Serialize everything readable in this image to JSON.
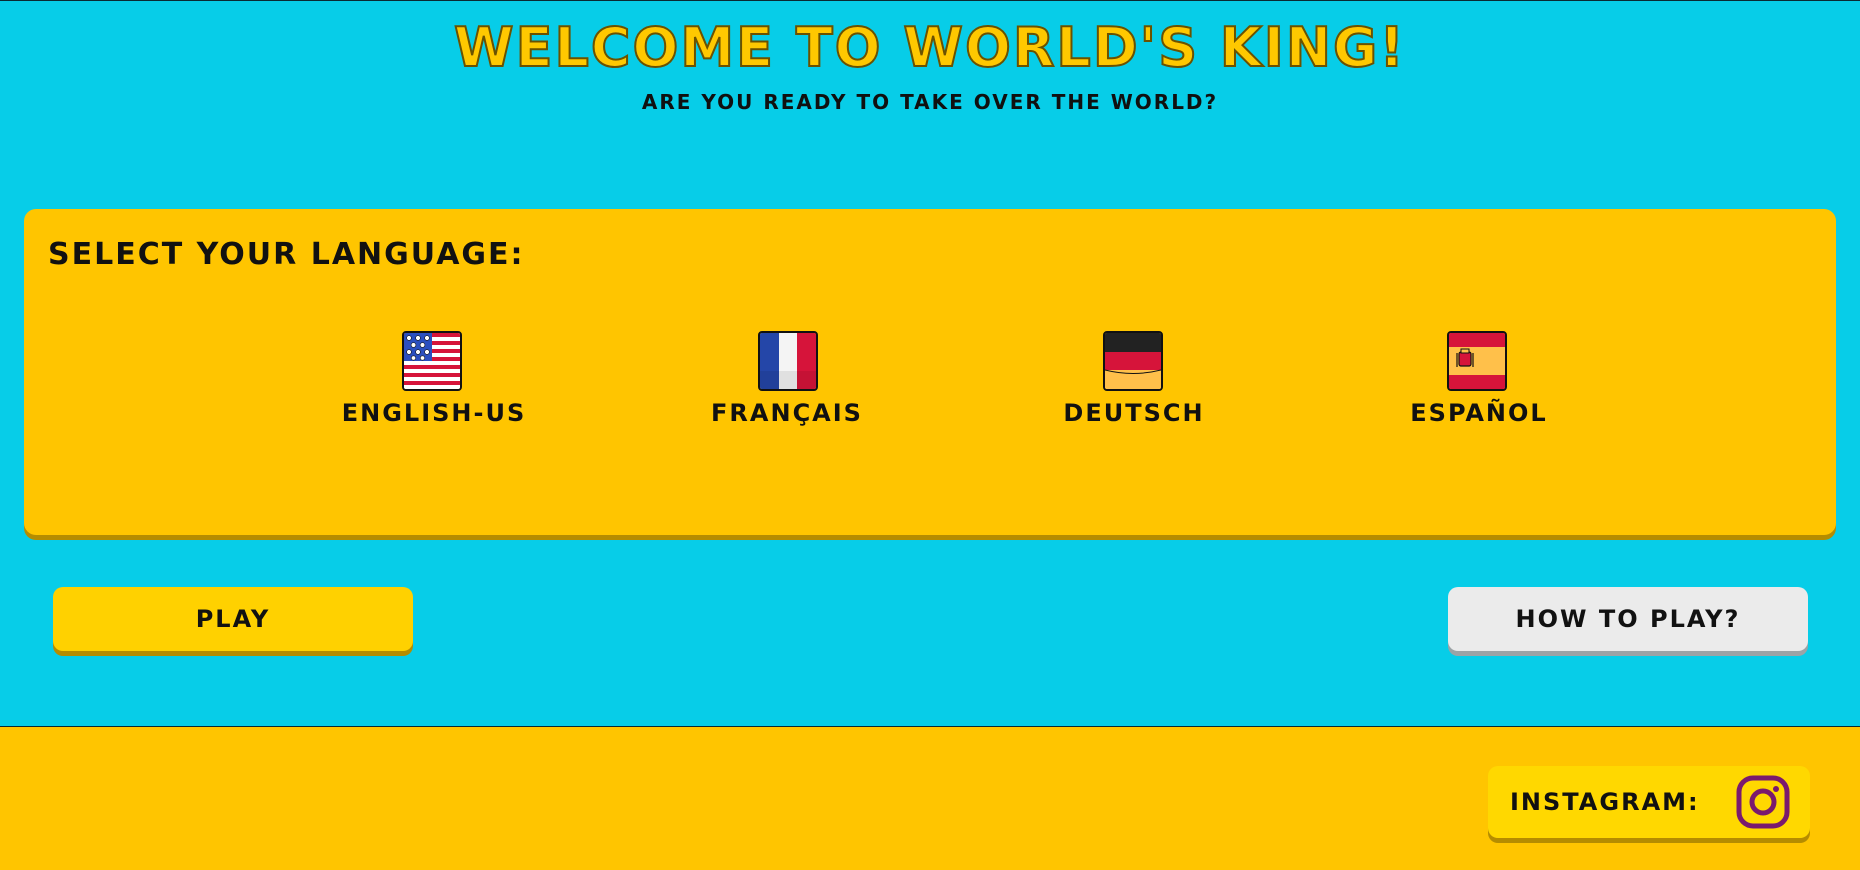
{
  "header": {
    "title": "WELCOME TO WORLD'S KING!",
    "subtitle": "ARE YOU READY TO TAKE OVER THE WORLD?"
  },
  "language_panel": {
    "heading": "SELECT YOUR LANGUAGE:",
    "options": [
      {
        "label": "ENGLISH-US",
        "icon": "us-flag-icon"
      },
      {
        "label": "FRANÇAIS",
        "icon": "france-flag-icon"
      },
      {
        "label": "DEUTSCH",
        "icon": "germany-flag-icon"
      },
      {
        "label": "ESPAÑOL",
        "icon": "spain-flag-icon"
      }
    ]
  },
  "actions": {
    "play_label": "PLAY",
    "how_to_play_label": "HOW TO PLAY?"
  },
  "footer": {
    "instagram_label": "INSTAGRAM:",
    "instagram_icon": "instagram-icon"
  },
  "colors": {
    "background": "#07cde8",
    "panel": "#ffc500",
    "title": "#ffc800",
    "play_button": "#ffd100",
    "how_to_play_button": "#ebebeb",
    "instagram_icon": "#7a1a6e"
  }
}
